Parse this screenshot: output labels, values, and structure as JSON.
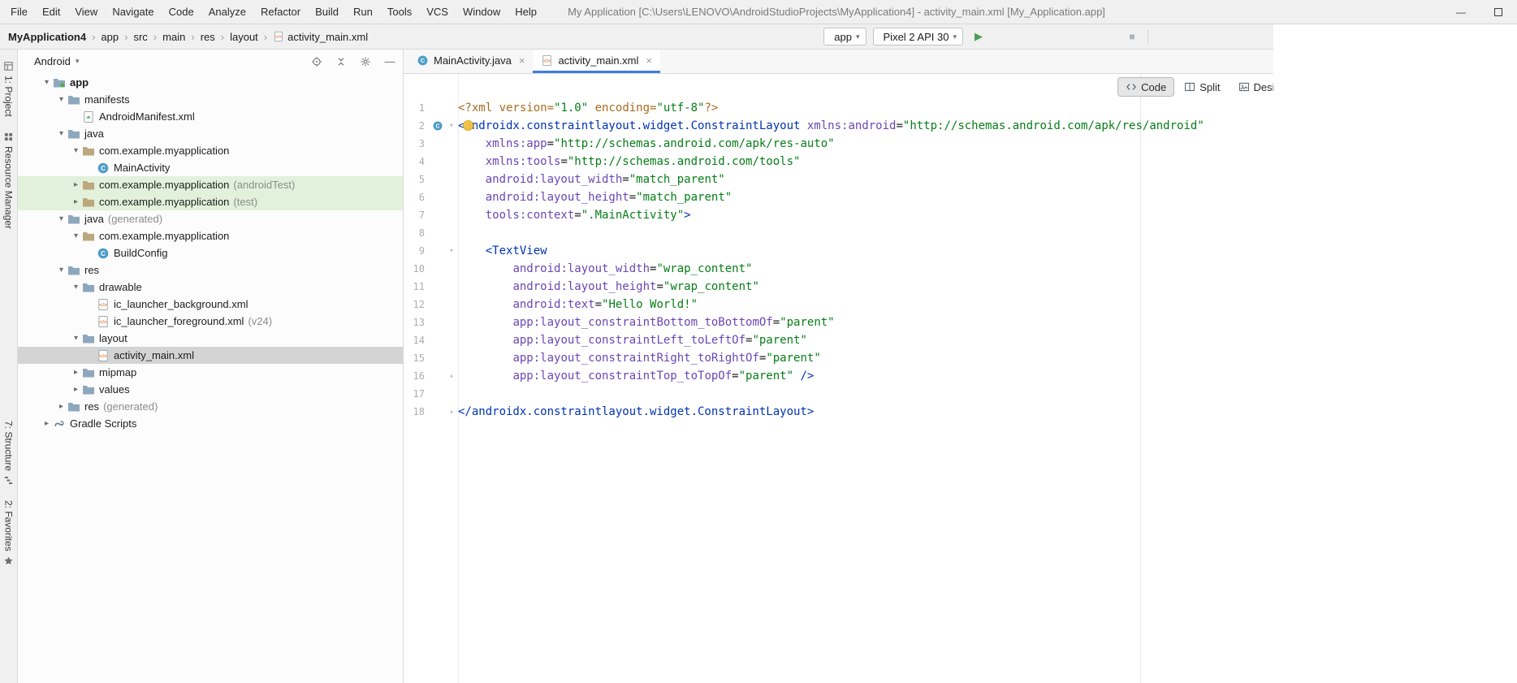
{
  "window": {
    "title": "My Application [C:\\Users\\LENOVO\\AndroidStudioProjects\\MyApplication4] - activity_main.xml [My_Application.app]",
    "controls": [
      {
        "name": "minimize",
        "glyph": "—"
      },
      {
        "name": "maximize",
        "glyph": "▢"
      }
    ]
  },
  "glyphs": {
    "expanded": "▾",
    "collapsed": "▸",
    "dropdown": "▾",
    "breadcrumb_sep": "›",
    "close": "×",
    "fold_open": "▾",
    "fold_end": "▴",
    "run": "▶",
    "stop": "■",
    "hide": "—"
  },
  "colors": {
    "accent_blue": "#3d7fd9",
    "selection_gray": "#d4d4d4",
    "test_source_green_bg": "#e2f1db",
    "run_green": "#4c9e53",
    "xml_tag_blue": "#0033b3",
    "xml_attr_purple": "#6a46b5",
    "xml_string_green": "#067d17",
    "xml_prologue_orange": "#a86b1e"
  },
  "menu_bar": {
    "items": [
      "File",
      "Edit",
      "View",
      "Navigate",
      "Code",
      "Analyze",
      "Refactor",
      "Build",
      "Run",
      "Tools",
      "VCS",
      "Window",
      "Help"
    ]
  },
  "toolbar": {
    "breadcrumbs": [
      "MyApplication4",
      "app",
      "src",
      "main",
      "res",
      "layout",
      "activity_main.xml"
    ],
    "build": {
      "name": "build",
      "svg": "hammer"
    },
    "run_config": {
      "label": "app",
      "icon": "android-head"
    },
    "device": {
      "label": "Pixel 2 API 30",
      "icon": "device"
    },
    "actions": [
      {
        "name": "run",
        "glyph": "▶",
        "color": "#4c9e53",
        "size": 13
      },
      {
        "name": "apply-changes",
        "svg": "sync"
      },
      {
        "name": "apply-code-changes",
        "svg": "apply-code"
      },
      {
        "name": "debug",
        "svg": "bug"
      },
      {
        "name": "profile",
        "svg": "gauge"
      },
      {
        "name": "profiler",
        "svg": "chart"
      },
      {
        "name": "attach-debugger",
        "svg": "wrench"
      },
      {
        "name": "stop",
        "glyph": "■",
        "color": "#acb2b8",
        "size": 12
      },
      {
        "sep": true
      },
      {
        "name": "device-manager",
        "svg": "device"
      },
      {
        "name": "sync-project",
        "svg": "sync"
      },
      {
        "name": "sdk-manager",
        "svg": "download"
      },
      {
        "name": "logcat",
        "svg": "terminal"
      },
      {
        "name": "layout-inspector",
        "svg": "inspect"
      },
      {
        "name": "more",
        "svg": "device",
        "clip": true
      }
    ]
  },
  "tool_window_bars": {
    "top": [
      {
        "label": "1: Project",
        "name": "project",
        "svg": "project"
      },
      {
        "label": "Resource Manager",
        "name": "resource-manager",
        "svg": "grid"
      }
    ],
    "bottom": [
      {
        "label": "7: Structure",
        "name": "structure",
        "svg": "structure"
      },
      {
        "label": "2: Favorites",
        "name": "favorites",
        "svg": "star"
      }
    ]
  },
  "project_panel": {
    "view": "Android",
    "icons": [
      {
        "name": "locate-file",
        "svg": "target"
      },
      {
        "name": "collapse-all",
        "svg": "collapse"
      },
      {
        "name": "settings",
        "svg": "gear"
      },
      {
        "name": "hide-panel",
        "glyph": "—"
      }
    ],
    "tree": [
      {
        "label": "app",
        "icon": "module",
        "level": 0,
        "expand": "open",
        "bold": true
      },
      {
        "label": "manifests",
        "icon": "folder",
        "level": 1,
        "expand": "open"
      },
      {
        "label": "AndroidManifest.xml",
        "icon": "manifest",
        "level": 2
      },
      {
        "label": "java",
        "icon": "folder",
        "level": 1,
        "expand": "open"
      },
      {
        "label": "com.example.myapplication",
        "icon": "package",
        "level": 2,
        "expand": "open"
      },
      {
        "label": "MainActivity",
        "icon": "class",
        "level": 3
      },
      {
        "label": "com.example.myapplication",
        "suffix": "(androidTest)",
        "icon": "package",
        "level": 2,
        "expand": "closed",
        "bg": "green"
      },
      {
        "label": "com.example.myapplication",
        "suffix": "(test)",
        "icon": "package",
        "level": 2,
        "expand": "closed",
        "bg": "green"
      },
      {
        "label": "java",
        "suffix": "(generated)",
        "icon": "folder",
        "level": 1,
        "expand": "open"
      },
      {
        "label": "com.example.myapplication",
        "icon": "package",
        "level": 2,
        "expand": "open"
      },
      {
        "label": "BuildConfig",
        "icon": "class",
        "level": 3
      },
      {
        "label": "res",
        "icon": "folder",
        "level": 1,
        "expand": "open"
      },
      {
        "label": "drawable",
        "icon": "folder",
        "level": 2,
        "expand": "open"
      },
      {
        "label": "ic_launcher_background.xml",
        "icon": "xml",
        "level": 3
      },
      {
        "label": "ic_launcher_foreground.xml",
        "suffix": "(v24)",
        "icon": "xml",
        "level": 3
      },
      {
        "label": "layout",
        "icon": "folder",
        "level": 2,
        "expand": "open"
      },
      {
        "label": "activity_main.xml",
        "icon": "xml",
        "level": 3,
        "selected": true
      },
      {
        "label": "mipmap",
        "icon": "folder",
        "level": 2,
        "expand": "closed"
      },
      {
        "label": "values",
        "icon": "folder",
        "level": 2,
        "expand": "closed"
      },
      {
        "label": "res",
        "suffix": "(generated)",
        "icon": "folder",
        "level": 1,
        "expand": "closed"
      },
      {
        "label": "Gradle Scripts",
        "icon": "gradle",
        "level": 0,
        "expand": "closed"
      }
    ]
  },
  "editor": {
    "tabs": [
      {
        "label": "MainActivity.java",
        "icon": "class"
      },
      {
        "label": "activity_main.xml",
        "icon": "xml",
        "active": true
      }
    ],
    "modes": [
      {
        "label": "Code",
        "svg": "code-mode",
        "active": true
      },
      {
        "label": "Split",
        "svg": "split-mode"
      },
      {
        "label": "Design",
        "svg": "design-mode"
      }
    ],
    "code_lines": [
      {
        "n": 1,
        "tokens": [
          [
            "<?xml version=",
            "pi"
          ],
          [
            "\"1.0\"",
            "str"
          ],
          [
            " encoding=",
            "pi"
          ],
          [
            "\"utf-8\"",
            "str"
          ],
          [
            "?>",
            "pi"
          ]
        ]
      },
      {
        "n": 2,
        "gutter": "class",
        "fold": "down",
        "bulb": true,
        "tokens": [
          [
            "<androidx.constraintlayout.widget.ConstraintLayout ",
            "tag"
          ],
          [
            "xmlns:android",
            "attr"
          ],
          [
            "=",
            "pl"
          ],
          [
            "\"http://schemas.android.com/apk/res/android\"",
            "str"
          ]
        ]
      },
      {
        "n": 3,
        "tokens": [
          [
            "    ",
            "pl"
          ],
          [
            "xmlns:app",
            "attr"
          ],
          [
            "=",
            "pl"
          ],
          [
            "\"http://schemas.android.com/apk/res-auto\"",
            "str"
          ]
        ]
      },
      {
        "n": 4,
        "tokens": [
          [
            "    ",
            "pl"
          ],
          [
            "xmlns:tools",
            "attr"
          ],
          [
            "=",
            "pl"
          ],
          [
            "\"http://schemas.android.com/tools\"",
            "str"
          ]
        ]
      },
      {
        "n": 5,
        "tokens": [
          [
            "    ",
            "pl"
          ],
          [
            "android:layout_width",
            "attr"
          ],
          [
            "=",
            "pl"
          ],
          [
            "\"match_parent\"",
            "str"
          ]
        ]
      },
      {
        "n": 6,
        "tokens": [
          [
            "    ",
            "pl"
          ],
          [
            "android:layout_height",
            "attr"
          ],
          [
            "=",
            "pl"
          ],
          [
            "\"match_parent\"",
            "str"
          ]
        ]
      },
      {
        "n": 7,
        "tokens": [
          [
            "    ",
            "pl"
          ],
          [
            "tools:context",
            "attr"
          ],
          [
            "=",
            "pl"
          ],
          [
            "\".MainActivity\"",
            "str"
          ],
          [
            ">",
            "tag"
          ]
        ]
      },
      {
        "n": 8,
        "tokens": []
      },
      {
        "n": 9,
        "fold": "down",
        "tokens": [
          [
            "    ",
            "pl"
          ],
          [
            "<TextView",
            "tag"
          ]
        ]
      },
      {
        "n": 10,
        "tokens": [
          [
            "        ",
            "pl"
          ],
          [
            "android:layout_width",
            "attr"
          ],
          [
            "=",
            "pl"
          ],
          [
            "\"wrap_content\"",
            "str"
          ]
        ]
      },
      {
        "n": 11,
        "tokens": [
          [
            "        ",
            "pl"
          ],
          [
            "android:layout_height",
            "attr"
          ],
          [
            "=",
            "pl"
          ],
          [
            "\"wrap_content\"",
            "str"
          ]
        ]
      },
      {
        "n": 12,
        "tokens": [
          [
            "        ",
            "pl"
          ],
          [
            "android:text",
            "attr"
          ],
          [
            "=",
            "pl"
          ],
          [
            "\"Hello World!\"",
            "str"
          ]
        ]
      },
      {
        "n": 13,
        "tokens": [
          [
            "        ",
            "pl"
          ],
          [
            "app:layout_constraintBottom_toBottomOf",
            "attr"
          ],
          [
            "=",
            "pl"
          ],
          [
            "\"parent\"",
            "str"
          ]
        ]
      },
      {
        "n": 14,
        "tokens": [
          [
            "        ",
            "pl"
          ],
          [
            "app:layout_constraintLeft_toLeftOf",
            "attr"
          ],
          [
            "=",
            "pl"
          ],
          [
            "\"parent\"",
            "str"
          ]
        ]
      },
      {
        "n": 15,
        "tokens": [
          [
            "        ",
            "pl"
          ],
          [
            "app:layout_constraintRight_toRightOf",
            "attr"
          ],
          [
            "=",
            "pl"
          ],
          [
            "\"parent\"",
            "str"
          ]
        ]
      },
      {
        "n": 16,
        "fold": "up",
        "tokens": [
          [
            "        ",
            "pl"
          ],
          [
            "app:layout_constraintTop_toTopOf",
            "attr"
          ],
          [
            "=",
            "pl"
          ],
          [
            "\"parent\"",
            "str"
          ],
          [
            " />",
            "tag"
          ]
        ]
      },
      {
        "n": 17,
        "tokens": []
      },
      {
        "n": 18,
        "fold": "up",
        "tokens": [
          [
            "</androidx.constraintlayout.widget.ConstraintLayout>",
            "tag"
          ]
        ]
      }
    ]
  }
}
